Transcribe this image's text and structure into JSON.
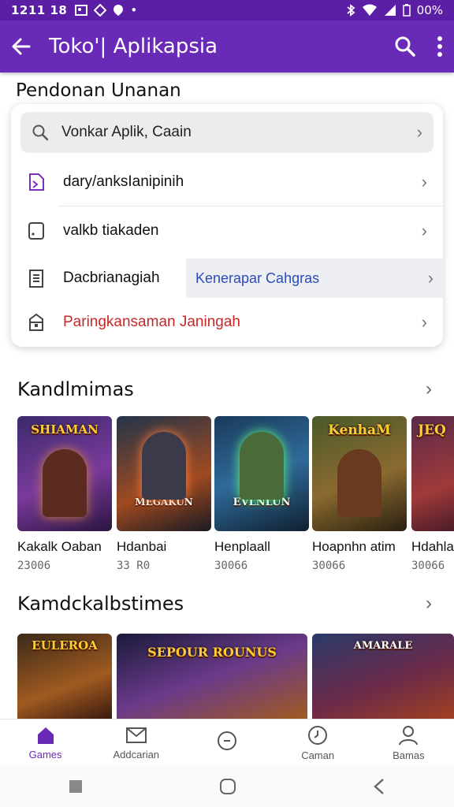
{
  "status_bar": {
    "time": "1211 18",
    "battery": "00%",
    "bar_color": "#5b1fa6"
  },
  "app_bar": {
    "title": "Toko'| Aplikapsia",
    "back_icon": "arrow-left-icon",
    "search_icon": "search-icon",
    "more_icon": "more-vert-icon",
    "color": "#6a2ab8"
  },
  "menu_section": {
    "heading": "Pendonan Unanan",
    "search_label": "Vonkar Aplik, Caain",
    "items": [
      {
        "label": "dary/anksIanipinih",
        "icon": "file-share-icon"
      },
      {
        "label": "valkb tiakaden",
        "icon": "device-icon"
      },
      {
        "label": "Dacbrianagiah",
        "icon": "document-icon"
      },
      {
        "label": "Paringkansaman Janingah",
        "icon": "lock-icon",
        "color": "#c62828"
      }
    ],
    "hint_label": "Kenerapar Cahgras",
    "hint_color": "#2a4bbf"
  },
  "section1": {
    "heading": "Kandlmimas",
    "games": [
      {
        "name": "Kakalk Oaban",
        "size": "23006",
        "art": "SHIAMAN"
      },
      {
        "name": "Hdanbai",
        "size": "33 R0",
        "art": "MEGAKUN"
      },
      {
        "name": "Henplaall",
        "size": "30066",
        "art": "EVLNLUN"
      },
      {
        "name": "Hoapnhn atim",
        "size": "30066",
        "art": "KenhaM"
      },
      {
        "name": "Hdahla",
        "size": "30066",
        "art": "JEQ"
      }
    ]
  },
  "section2": {
    "heading": "Kamdckalbstimes",
    "games": [
      {
        "art": "EULEROA"
      },
      {
        "art": "SEPOUR ROUNUS"
      },
      {
        "art": "AMARALE"
      }
    ]
  },
  "bottom_nav": {
    "items": [
      {
        "label": "Games",
        "icon": "home-icon",
        "active": true
      },
      {
        "label": "Addcarian",
        "icon": "mail-icon",
        "active": false
      },
      {
        "label": "",
        "icon": "chat-icon",
        "active": false
      },
      {
        "label": "Caman",
        "icon": "clock-icon",
        "active": false
      },
      {
        "label": "Bamas",
        "icon": "person-icon",
        "active": false
      }
    ],
    "active_color": "#6a2ab8"
  },
  "system_nav": {
    "recent_icon": "recent-square-icon",
    "home_icon": "home-circle-icon",
    "back_icon": "back-triangle-icon"
  }
}
